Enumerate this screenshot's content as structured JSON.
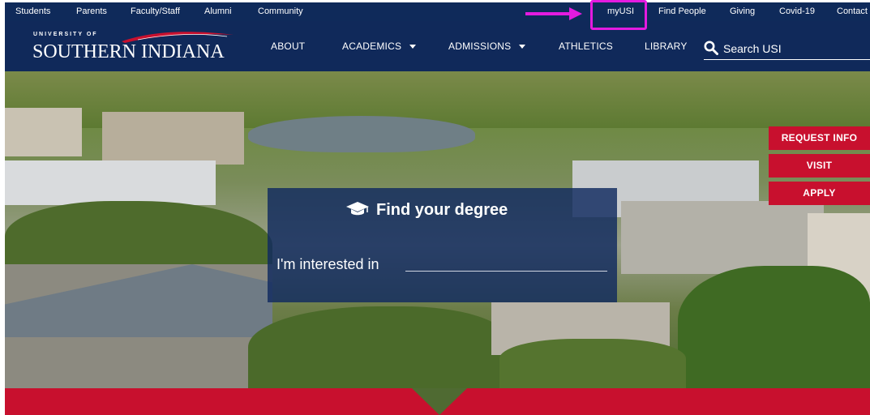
{
  "utility_nav": {
    "left": [
      "Students",
      "Parents",
      "Faculty/Staff",
      "Alumni",
      "Community"
    ],
    "right": [
      "myUSI",
      "Find People",
      "Giving",
      "Covid-19",
      "Contact"
    ]
  },
  "logo": {
    "small": "UNIVERSITY OF",
    "main": "SOUTHERN INDIANA"
  },
  "main_nav": {
    "items": [
      "ABOUT",
      "ACADEMICS",
      "ADMISSIONS",
      "ATHLETICS",
      "LIBRARY"
    ]
  },
  "search": {
    "placeholder": "Search USI"
  },
  "degree_finder": {
    "title": "Find your degree",
    "label": "I'm interested in",
    "value": ""
  },
  "side_buttons": [
    "REQUEST INFO",
    "VISIT",
    "APPLY"
  ],
  "colors": {
    "navy": "#10295a",
    "red": "#c8102e",
    "annotation": "#e41be0"
  },
  "icons": {
    "search": "search-icon",
    "degree": "graduation-cap-icon",
    "annotation_arrow": "arrow-right-icon"
  }
}
